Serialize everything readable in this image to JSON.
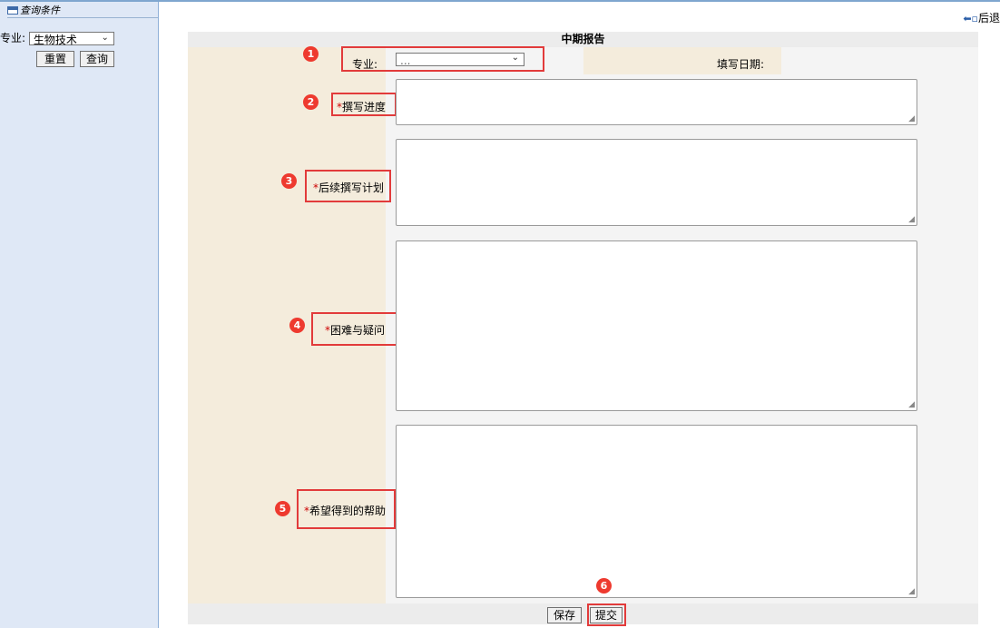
{
  "sidebar": {
    "header": "查询条件",
    "field_label": "专业:",
    "select_value": "生物技术",
    "reset_button": "重置",
    "query_button": "查询"
  },
  "topbar": {
    "back_label": "后退"
  },
  "form": {
    "title": "中期报告",
    "major_label": "专业:",
    "major_select_value": "...",
    "date_label": "填写日期:",
    "required_mark": "*",
    "fields": [
      {
        "label": "撰写进度",
        "badge": "2"
      },
      {
        "label": "后续撰写计划",
        "badge": "3"
      },
      {
        "label": "困难与疑问",
        "badge": "4"
      },
      {
        "label": "希望得到的帮助",
        "badge": "5"
      }
    ],
    "badges": {
      "major": "1",
      "submit": "6"
    },
    "save_button": "保存",
    "submit_button": "提交"
  },
  "colors": {
    "label_bg": "#f4ecdc",
    "sidebar_bg": "#dfe8f6",
    "annotation_red": "#e23b3b"
  }
}
